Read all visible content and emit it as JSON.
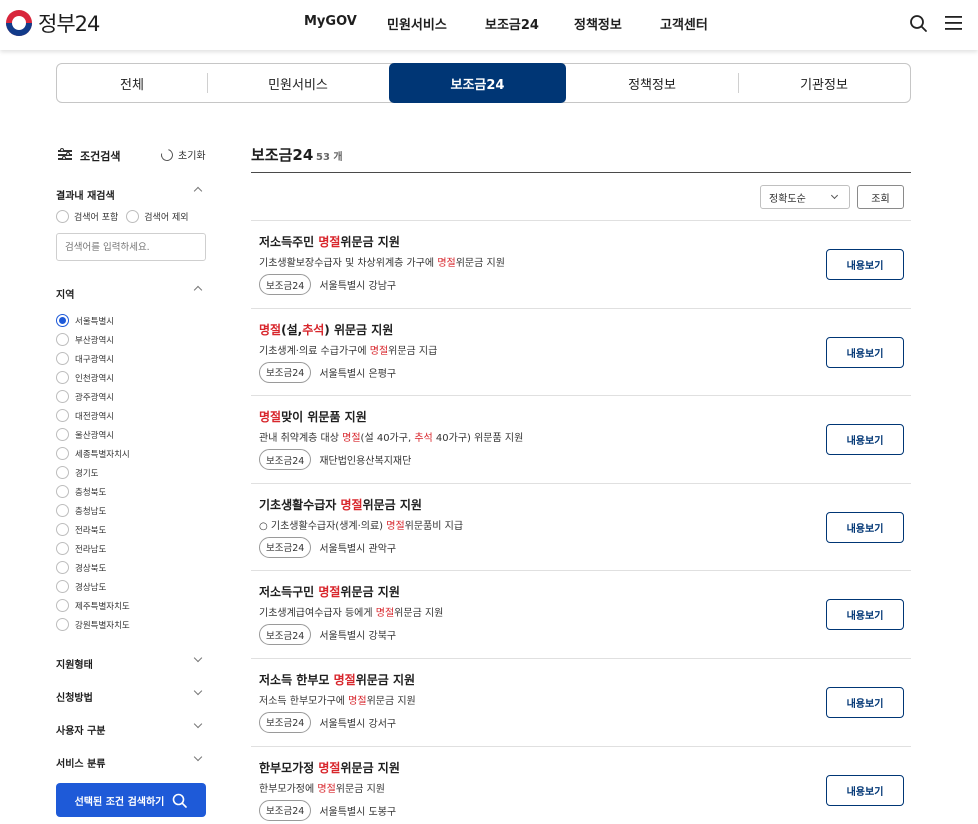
{
  "header": {
    "logo_text": "정부24",
    "nav": [
      "MyGOV",
      "민원서비스",
      "보조금24",
      "정책정보",
      "고객센터"
    ],
    "icons": [
      "search-icon",
      "menu-icon"
    ]
  },
  "tabs": [
    "전체",
    "민원서비스",
    "보조금24",
    "정책정보",
    "기관정보"
  ],
  "active_tab": "보조금24",
  "sidebar": {
    "condition_title": "조건검색",
    "reset_label": "초기화",
    "keyword_section": {
      "title": "결과내 재검색",
      "options": [
        "검색어 포함",
        "검색어 제외"
      ],
      "placeholder": "검색어를 입력하세요."
    },
    "region_section": {
      "title": "지역",
      "selected": "서울특별시",
      "items": [
        "서울특별시",
        "부산광역시",
        "대구광역시",
        "인천광역시",
        "광주광역시",
        "대전광역시",
        "울산광역시",
        "세종특별자치시",
        "경기도",
        "충청북도",
        "충청남도",
        "전라북도",
        "전라남도",
        "경상북도",
        "경상남도",
        "제주특별자치도",
        "강원특별자치도"
      ]
    },
    "collapsed_sections": [
      "지원형태",
      "신청방법",
      "사용자 구분",
      "서비스 분류"
    ],
    "search_button": "선택된 조건 검색하기"
  },
  "main": {
    "title": "보조금24",
    "count": "53 개",
    "sort_value": "정확도순",
    "query_button": "조회",
    "view_button": "내용보기",
    "accent_color": "#d8262c",
    "results": [
      {
        "title": [
          [
            "저소득주민 ",
            false
          ],
          [
            "명절",
            true
          ],
          [
            "위문금 지원",
            false
          ]
        ],
        "desc": [
          [
            "기초생활보장수급자 및 차상위계층 가구에 ",
            false
          ],
          [
            "명절",
            true
          ],
          [
            "위문금 지원",
            false
          ]
        ],
        "tag": "보조금24",
        "agency": "서울특별시 강남구"
      },
      {
        "title": [
          [
            "명절",
            true
          ],
          [
            "(설,",
            false
          ],
          [
            "추석",
            true
          ],
          [
            ") 위문금 지원",
            false
          ]
        ],
        "desc": [
          [
            "기초생계·의료 수급가구에 ",
            false
          ],
          [
            "명절",
            true
          ],
          [
            "위문금 지급",
            false
          ]
        ],
        "tag": "보조금24",
        "agency": "서울특별시 은평구"
      },
      {
        "title": [
          [
            "명절",
            true
          ],
          [
            "맞이 위문품 지원",
            false
          ]
        ],
        "desc": [
          [
            "관내 취약계층 대상 ",
            false
          ],
          [
            "명절",
            true
          ],
          [
            "(설 40가구, ",
            false
          ],
          [
            "추석",
            true
          ],
          [
            " 40가구) 위문품 지원",
            false
          ]
        ],
        "tag": "보조금24",
        "agency": "재단법인용산복지재단"
      },
      {
        "title": [
          [
            "기초생활수급자 ",
            false
          ],
          [
            "명절",
            true
          ],
          [
            "위문금 지원",
            false
          ]
        ],
        "desc": [
          [
            "○ 기초생활수급자(생계·의료) ",
            false
          ],
          [
            "명절",
            true
          ],
          [
            "위문품비 지급",
            false
          ]
        ],
        "tag": "보조금24",
        "agency": "서울특별시 관악구"
      },
      {
        "title": [
          [
            "저소득구민 ",
            false
          ],
          [
            "명절",
            true
          ],
          [
            "위문금 지원",
            false
          ]
        ],
        "desc": [
          [
            "기초생계급여수급자 등에게 ",
            false
          ],
          [
            "명절",
            true
          ],
          [
            "위문금 지원",
            false
          ]
        ],
        "tag": "보조금24",
        "agency": "서울특별시 강북구"
      },
      {
        "title": [
          [
            "저소득 한부모 ",
            false
          ],
          [
            "명절",
            true
          ],
          [
            "위문금 지원",
            false
          ]
        ],
        "desc": [
          [
            "저소득 한부모가구에 ",
            false
          ],
          [
            "명절",
            true
          ],
          [
            "위문금 지원",
            false
          ]
        ],
        "tag": "보조금24",
        "agency": "서울특별시 강서구"
      },
      {
        "title": [
          [
            "한부모가정 ",
            false
          ],
          [
            "명절",
            true
          ],
          [
            "위문금 지원",
            false
          ]
        ],
        "desc": [
          [
            "한부모가정에 ",
            false
          ],
          [
            "명절",
            true
          ],
          [
            "위문금 지원",
            false
          ]
        ],
        "tag": "보조금24",
        "agency": "서울특별시 도봉구"
      }
    ]
  }
}
